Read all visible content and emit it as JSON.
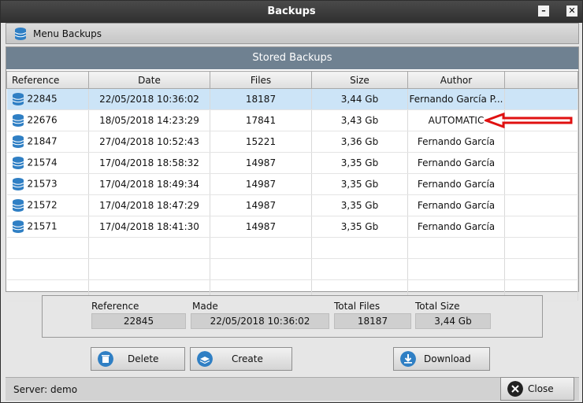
{
  "window": {
    "title": "Backups"
  },
  "menu": {
    "label": "Menu Backups"
  },
  "panel": {
    "title": "Stored Backups"
  },
  "table": {
    "columns": [
      "Reference",
      "Date",
      "Files",
      "Size",
      "Author"
    ],
    "rows": [
      {
        "reference": "22845",
        "date": "22/05/2018 10:36:02",
        "files": "18187",
        "size": "3,44 Gb",
        "author": "Fernando García P..."
      },
      {
        "reference": "22676",
        "date": "18/05/2018 14:23:29",
        "files": "17841",
        "size": "3,43 Gb",
        "author": "AUTOMATIC"
      },
      {
        "reference": "21847",
        "date": "27/04/2018 10:52:43",
        "files": "15221",
        "size": "3,36 Gb",
        "author": "Fernando García"
      },
      {
        "reference": "21574",
        "date": "17/04/2018 18:58:32",
        "files": "14987",
        "size": "3,35 Gb",
        "author": "Fernando García"
      },
      {
        "reference": "21573",
        "date": "17/04/2018 18:49:34",
        "files": "14987",
        "size": "3,35 Gb",
        "author": "Fernando García"
      },
      {
        "reference": "21572",
        "date": "17/04/2018 18:47:29",
        "files": "14987",
        "size": "3,35 Gb",
        "author": "Fernando García"
      },
      {
        "reference": "21571",
        "date": "17/04/2018 18:41:30",
        "files": "14987",
        "size": "3,35 Gb",
        "author": "Fernando García"
      }
    ]
  },
  "details": {
    "reference_label": "Reference",
    "reference_value": "22845",
    "made_label": "Made",
    "made_value": "22/05/2018 10:36:02",
    "files_label": "Total Files",
    "files_value": "18187",
    "size_label": "Total Size",
    "size_value": "3,44 Gb"
  },
  "buttons": {
    "delete": "Delete",
    "create": "Create",
    "download": "Download",
    "close": "Close"
  },
  "status": {
    "server": "Server: demo"
  },
  "colors": {
    "header": "#6f8191",
    "selected_row": "#cce4f7",
    "icon_blue": "#2f7fc4",
    "arrow": "#e01010"
  }
}
